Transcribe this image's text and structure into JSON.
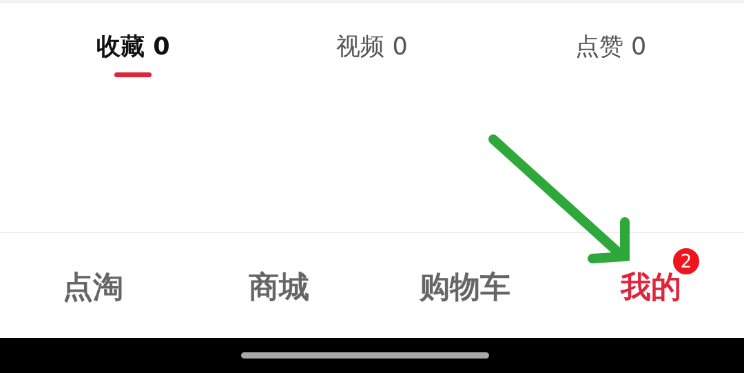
{
  "tabs": [
    {
      "label": "收藏 0",
      "selected": true
    },
    {
      "label": "视频 0",
      "selected": false
    },
    {
      "label": "点赞 0",
      "selected": false
    }
  ],
  "nav": [
    {
      "label": "点淘",
      "selected": false
    },
    {
      "label": "商城",
      "selected": false
    },
    {
      "label": "购物车",
      "selected": false
    },
    {
      "label": "我的",
      "selected": true,
      "badge": "2"
    }
  ]
}
